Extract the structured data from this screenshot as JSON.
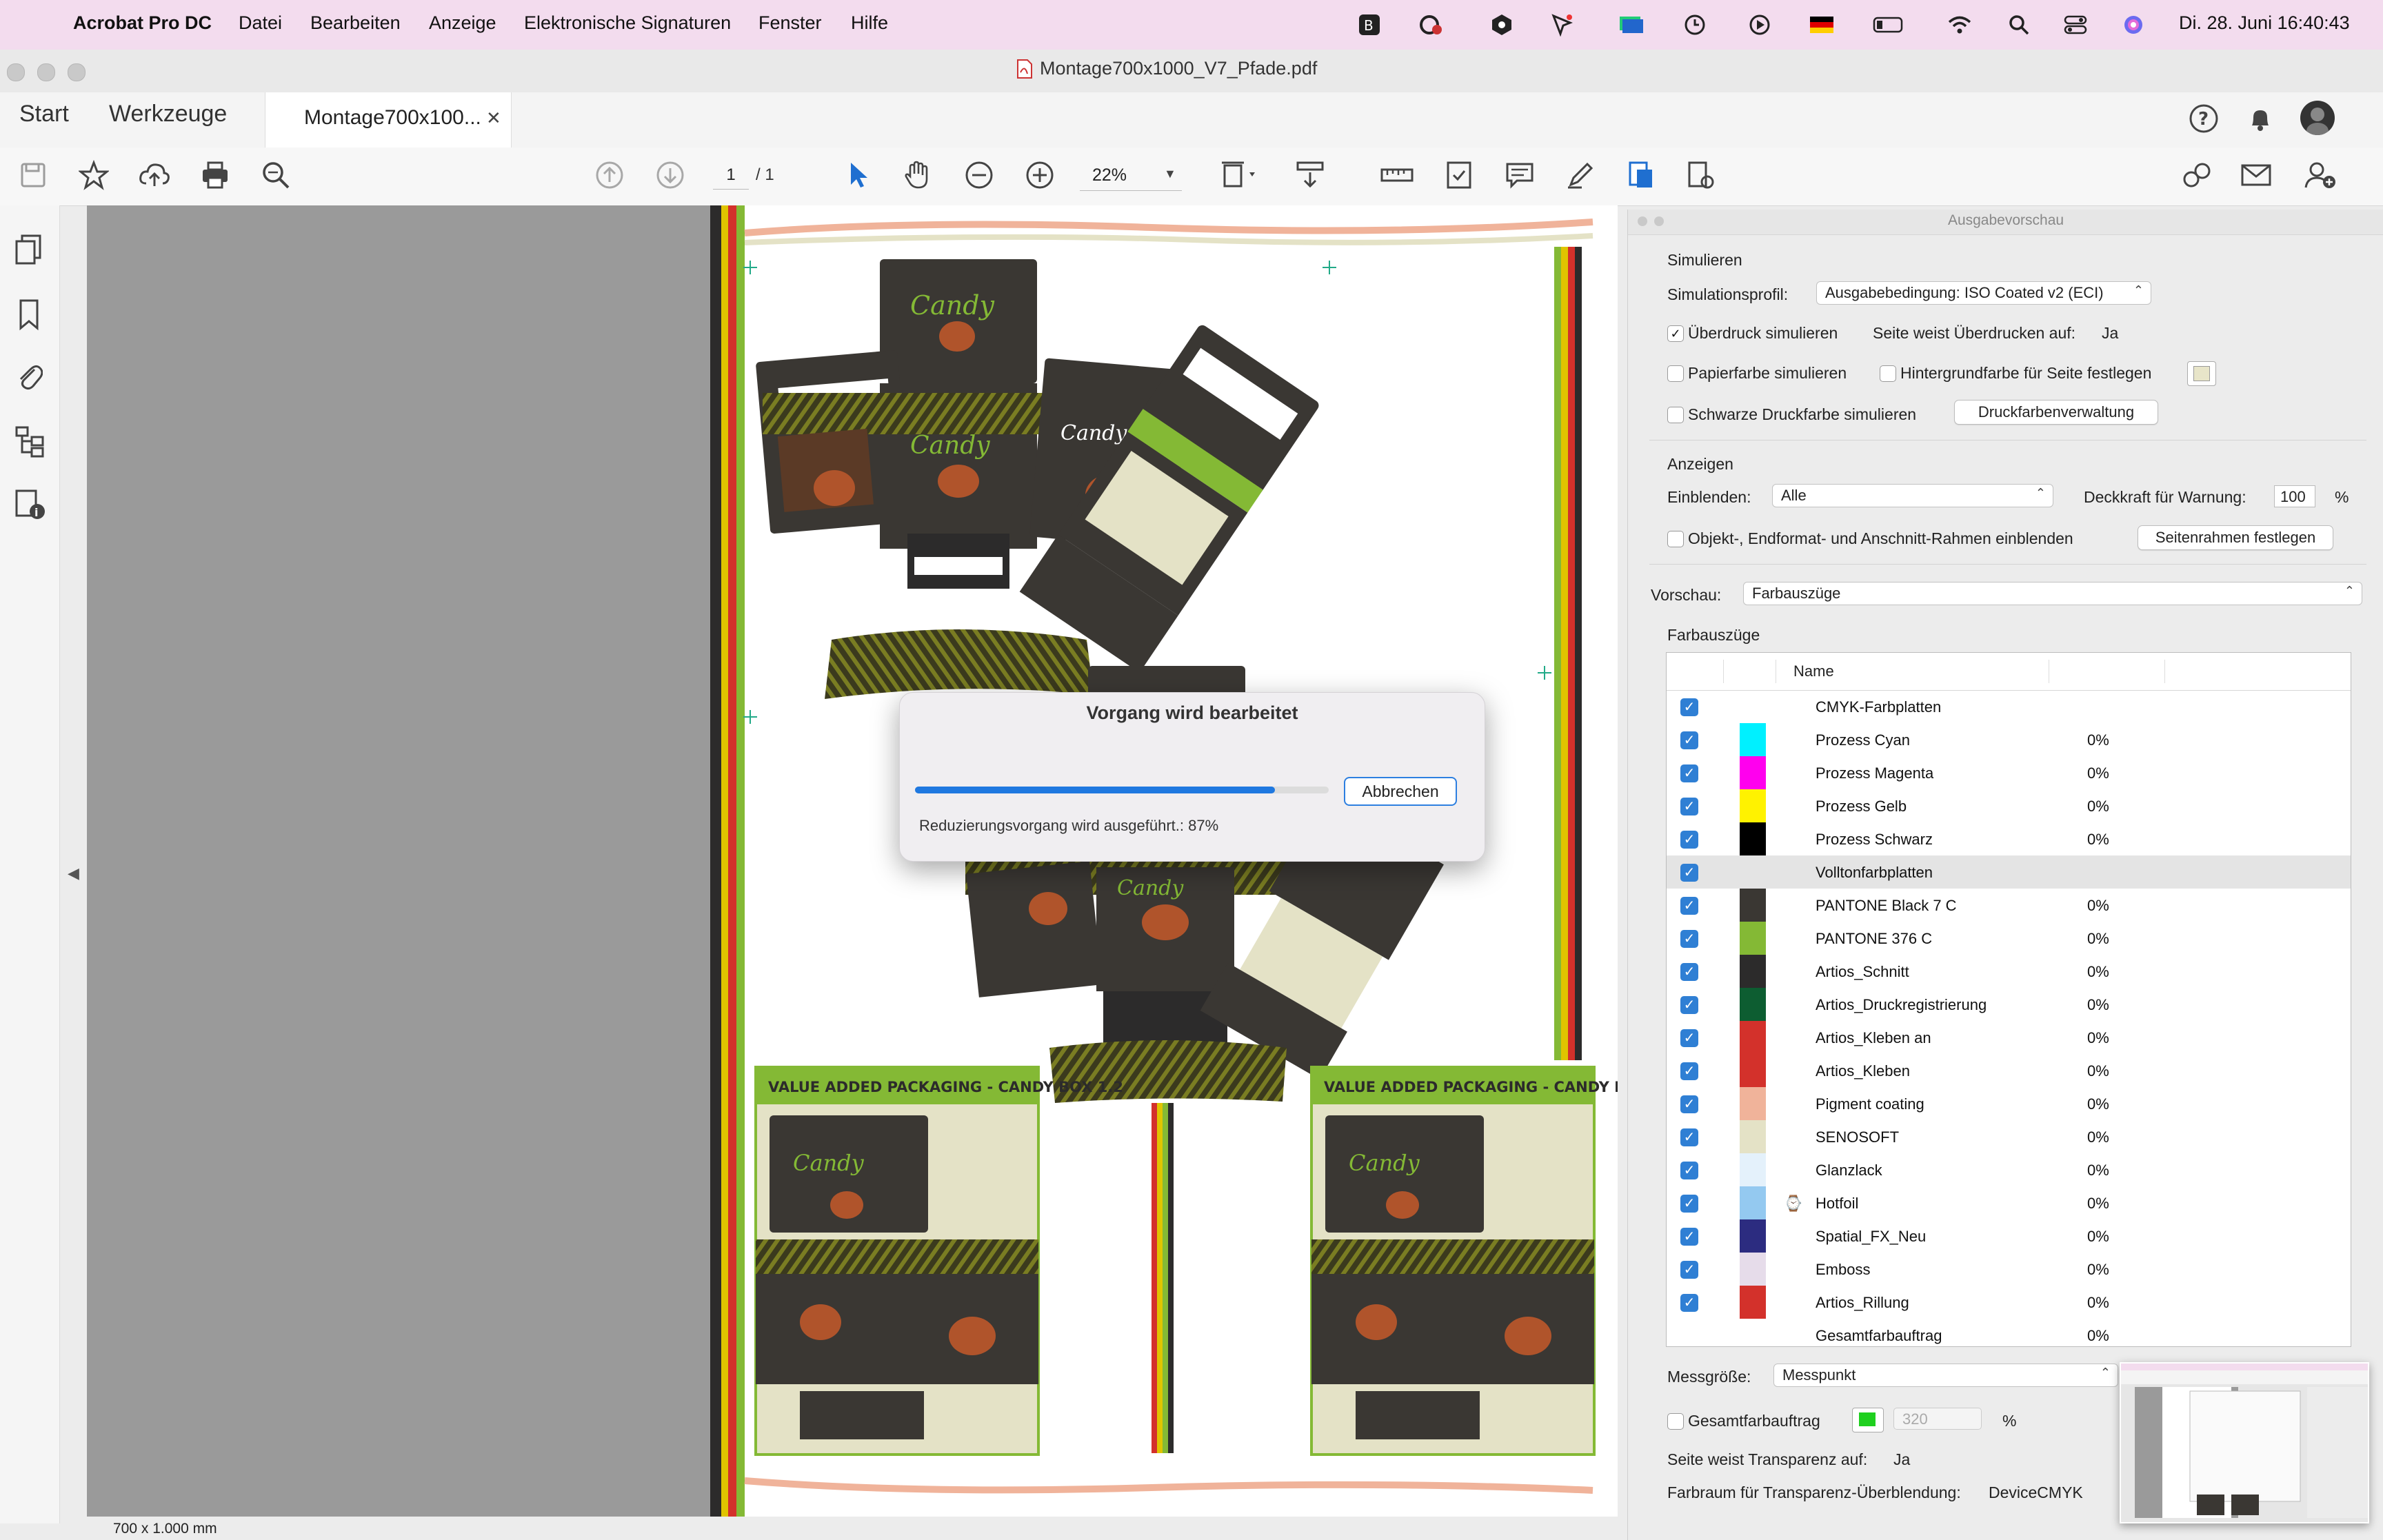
{
  "menubar": {
    "app": "Acrobat Pro DC",
    "items": [
      "Datei",
      "Bearbeiten",
      "Anzeige",
      "Elektronische Signaturen",
      "Fenster",
      "Hilfe"
    ],
    "clock": "Di. 28. Juni  16:40:43"
  },
  "window": {
    "title": "Montage700x1000_V7_Pfade.pdf"
  },
  "tabs": {
    "start": "Start",
    "tools": "Werkzeuge",
    "doc": "Montage700x100..."
  },
  "toolbar": {
    "page_current": "1",
    "page_total": "/  1",
    "zoom": "22%"
  },
  "statusbar": {
    "size": "700 x 1.000 mm"
  },
  "dialog": {
    "title": "Vorgang wird bearbeitet",
    "cancel": "Abbrechen",
    "message": "Reduzierungsvorgang wird ausgeführt.: 87%",
    "progress": 0.87
  },
  "panel": {
    "title": "Ausgabevorschau",
    "simulate_header": "Simulieren",
    "profile_label": "Simulationsprofil:",
    "profile_value": "Ausgabebedingung: ISO Coated v2 (ECI)",
    "overprint_label": "Überdruck simulieren",
    "overprint_checked": true,
    "page_overprint_label": "Seite weist Überdrucken auf:",
    "page_overprint_value": "Ja",
    "paper_label": "Papierfarbe simulieren",
    "bg_label": "Hintergrundfarbe für Seite festlegen",
    "black_label": "Schwarze Druckfarbe simulieren",
    "ink_manager": "Druckfarbenverwaltung",
    "show_header": "Anzeigen",
    "show_label": "Einblenden:",
    "show_value": "Alle",
    "opacity_label": "Deckkraft für Warnung:",
    "opacity_value": "100",
    "opacity_unit": "%",
    "frames_label": "Objekt-, Endformat- und Anschnitt-Rahmen einblenden",
    "frames_button": "Seitenrahmen festlegen",
    "preview_label": "Vorschau:",
    "preview_value": "Farbauszüge",
    "separations_header": "Farbauszüge",
    "name_col": "Name",
    "measure_label": "Messgröße:",
    "measure_value": "Messpunkt",
    "total_label": "Gesamtfarbauftrag",
    "total_value": "320",
    "total_unit": "%",
    "transparency_label": "Seite weist Transparenz auf:",
    "transparency_value": "Ja",
    "blend_label": "Farbraum für Transparenz-Überblendung:",
    "blend_value": "DeviceCMYK"
  },
  "separations": [
    {
      "name": "CMYK-Farbplatten",
      "pct": "",
      "color": ""
    },
    {
      "name": "Prozess Cyan",
      "pct": "0%",
      "color": "#00f0ff"
    },
    {
      "name": "Prozess Magenta",
      "pct": "0%",
      "color": "#ff00ee"
    },
    {
      "name": "Prozess Gelb",
      "pct": "0%",
      "color": "#fff200"
    },
    {
      "name": "Prozess Schwarz",
      "pct": "0%",
      "color": "#000000"
    },
    {
      "name": "Volltonfarbplatten",
      "pct": "",
      "color": ""
    },
    {
      "name": "PANTONE Black 7 C",
      "pct": "0%",
      "color": "#3a3733"
    },
    {
      "name": "PANTONE 376 C",
      "pct": "0%",
      "color": "#84b935"
    },
    {
      "name": "Artios_Schnitt",
      "pct": "0%",
      "color": "#2c2b2b"
    },
    {
      "name": "Artios_Druckregistrierung",
      "pct": "0%",
      "color": "#0d5d31"
    },
    {
      "name": "Artios_Kleben an",
      "pct": "0%",
      "color": "#d3312b"
    },
    {
      "name": "Artios_Kleben",
      "pct": "0%",
      "color": "#d3312b"
    },
    {
      "name": "Pigment coating",
      "pct": "0%",
      "color": "#f0b39a"
    },
    {
      "name": "SENOSOFT",
      "pct": "0%",
      "color": "#e4e2c6"
    },
    {
      "name": "Glanzlack",
      "pct": "0%",
      "color": "#e4f1fb"
    },
    {
      "name": "Hotfoil",
      "pct": "0%",
      "color": "#94c9f0"
    },
    {
      "name": "Spatial_FX_Neu",
      "pct": "0%",
      "color": "#2c2c80"
    },
    {
      "name": "Emboss",
      "pct": "0%",
      "color": "#e6dcea"
    },
    {
      "name": "Artios_Rillung",
      "pct": "0%",
      "color": "#d3312b"
    },
    {
      "name": "Gesamtfarbauftrag",
      "pct": "0%",
      "color": ""
    }
  ],
  "artwork": {
    "banner": "VALUE ADDED PACKAGING - CANDY BOX 1.2",
    "brand": "Candy"
  }
}
